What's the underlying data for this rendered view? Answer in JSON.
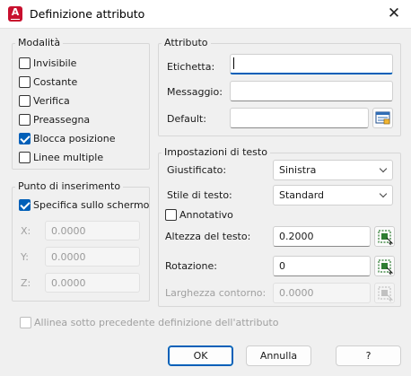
{
  "window": {
    "title": "Definizione attributo",
    "app_icon_letter": "A",
    "close_glyph": "✕"
  },
  "modalita": {
    "title": "Modalità",
    "items": [
      {
        "label": "Invisibile",
        "checked": false
      },
      {
        "label": "Costante",
        "checked": false
      },
      {
        "label": "Verifica",
        "checked": false
      },
      {
        "label": "Preassegna",
        "checked": false
      },
      {
        "label": "Blocca posizione",
        "checked": true
      },
      {
        "label": "Linee multiple",
        "checked": false
      }
    ]
  },
  "insertion": {
    "title": "Punto di inserimento",
    "specify_label": "Specifica sullo schermo",
    "specify_checked": true,
    "x_label": "X:",
    "x_value": "0.0000",
    "y_label": "Y:",
    "y_value": "0.0000",
    "z_label": "Z:",
    "z_value": "0.0000"
  },
  "attribute": {
    "title": "Attributo",
    "tag_label": "Etichetta:",
    "tag_value": "",
    "prompt_label": "Messaggio:",
    "prompt_value": "",
    "default_label": "Default:",
    "default_value": ""
  },
  "text_settings": {
    "title": "Impostazioni di testo",
    "justify_label": "Giustificato:",
    "justify_value": "Sinistra",
    "style_label": "Stile di testo:",
    "style_value": "Standard",
    "annotative_label": "Annotativo",
    "annotative_checked": false,
    "height_label": "Altezza del testo:",
    "height_value": "0.2000",
    "rotation_label": "Rotazione:",
    "rotation_value": "0",
    "boundary_label": "Larghezza contorno:",
    "boundary_value": "0.0000"
  },
  "align_below": {
    "label": "Allinea sotto precedente definizione dell'attributo",
    "checked": false
  },
  "buttons": {
    "ok": "OK",
    "cancel": "Annulla",
    "help": "?"
  },
  "colors": {
    "accent": "#005fb8",
    "app_icon": "#c8102e",
    "pick_icon": "#2e7d32"
  }
}
